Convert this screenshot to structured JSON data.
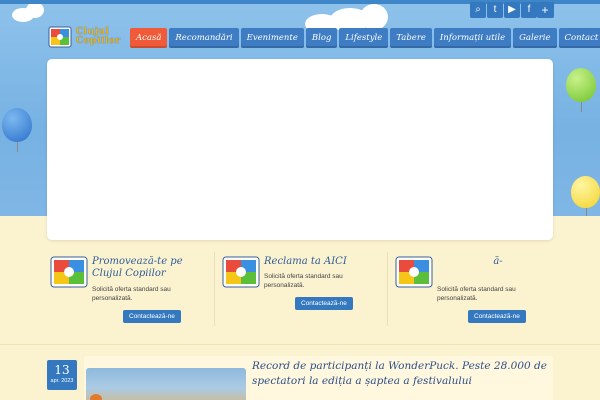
{
  "brand": {
    "line1": "Clujul",
    "line2": "Copiilor"
  },
  "social": {
    "icons": [
      "search-icon",
      "twitter-icon",
      "youtube-icon",
      "facebook-icon",
      "instagram-icon",
      "plus-icon"
    ],
    "glyphs": [
      "⌕",
      "t",
      "▶",
      "f",
      "◎",
      "+"
    ]
  },
  "nav": {
    "items": [
      "Acasă",
      "Recomandări",
      "Evenimente",
      "Blog",
      "Lifestyle",
      "Tabere",
      "Informații utile",
      "Galerie",
      "Contact"
    ],
    "active_index": 0
  },
  "promos": [
    {
      "title": "Promovează-te pe Clujul Copiilor",
      "text": "Solicită oferta standard sau personalizată.",
      "button": "Contactează-ne"
    },
    {
      "title": "Reclama ta AICI",
      "text": "Solicită oferta standard sau personalizată.",
      "button": "Contactează-ne"
    },
    {
      "title": "ă-",
      "text": "Solicită oferta standard sau personalizată.",
      "button": "Contactează-ne"
    }
  ],
  "article": {
    "day": "13",
    "month": "apr. 2023",
    "title": "Record de participanți la WonderPuck. Peste 28.000 de spectatori la ediția a șaptea a festivalului"
  },
  "colors": {
    "accent": "#3478bf",
    "active_nav": "#f05a38",
    "sky": "#7fb6e5",
    "sand": "#fbf2cf"
  }
}
